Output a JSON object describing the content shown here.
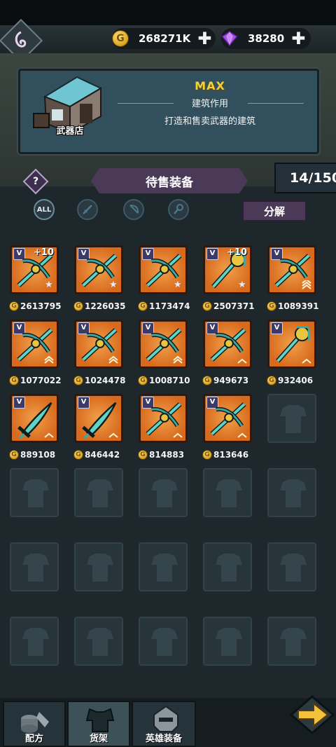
{
  "resources": {
    "gold": "268271K",
    "gems": "38280"
  },
  "building": {
    "name": "武器店",
    "level": "MAX",
    "function_title": "建筑作用",
    "description": "打造和售卖武器的建筑"
  },
  "shelf": {
    "title": "待售装备",
    "count": "14/150",
    "decompose_label": "分解",
    "filters": [
      "ALL"
    ]
  },
  "items": [
    {
      "price": "2613795",
      "plus": "+10",
      "weapon": "crossbow-icon",
      "badge": "star"
    },
    {
      "price": "1226035",
      "plus": "",
      "weapon": "crossbow-icon",
      "badge": "star"
    },
    {
      "price": "1173474",
      "plus": "",
      "weapon": "crossbow-icon",
      "badge": "star"
    },
    {
      "price": "2507371",
      "plus": "+10",
      "weapon": "staff-icon",
      "badge": "star"
    },
    {
      "price": "1089391",
      "plus": "",
      "weapon": "crossbow-icon",
      "badge": "rank3"
    },
    {
      "price": "1077022",
      "plus": "",
      "weapon": "crossbow-icon",
      "badge": "rank2"
    },
    {
      "price": "1024478",
      "plus": "",
      "weapon": "crossbow-icon",
      "badge": "rank2"
    },
    {
      "price": "1008710",
      "plus": "",
      "weapon": "crossbow-icon",
      "badge": "rank2"
    },
    {
      "price": "949673",
      "plus": "",
      "weapon": "crossbow-icon",
      "badge": "rank1"
    },
    {
      "price": "932406",
      "plus": "",
      "weapon": "staff-icon",
      "badge": "rank1"
    },
    {
      "price": "889108",
      "plus": "",
      "weapon": "sword-icon",
      "badge": "rank1"
    },
    {
      "price": "846442",
      "plus": "",
      "weapon": "sword-icon",
      "badge": "rank1"
    },
    {
      "price": "814883",
      "plus": "",
      "weapon": "crossbow-icon",
      "badge": "rank1"
    },
    {
      "price": "813646",
      "plus": "",
      "weapon": "crossbow-icon",
      "badge": "rank1"
    }
  ],
  "nav": {
    "recipes": "配方",
    "shelf": "货架",
    "hero_gear": "英雄装备"
  }
}
